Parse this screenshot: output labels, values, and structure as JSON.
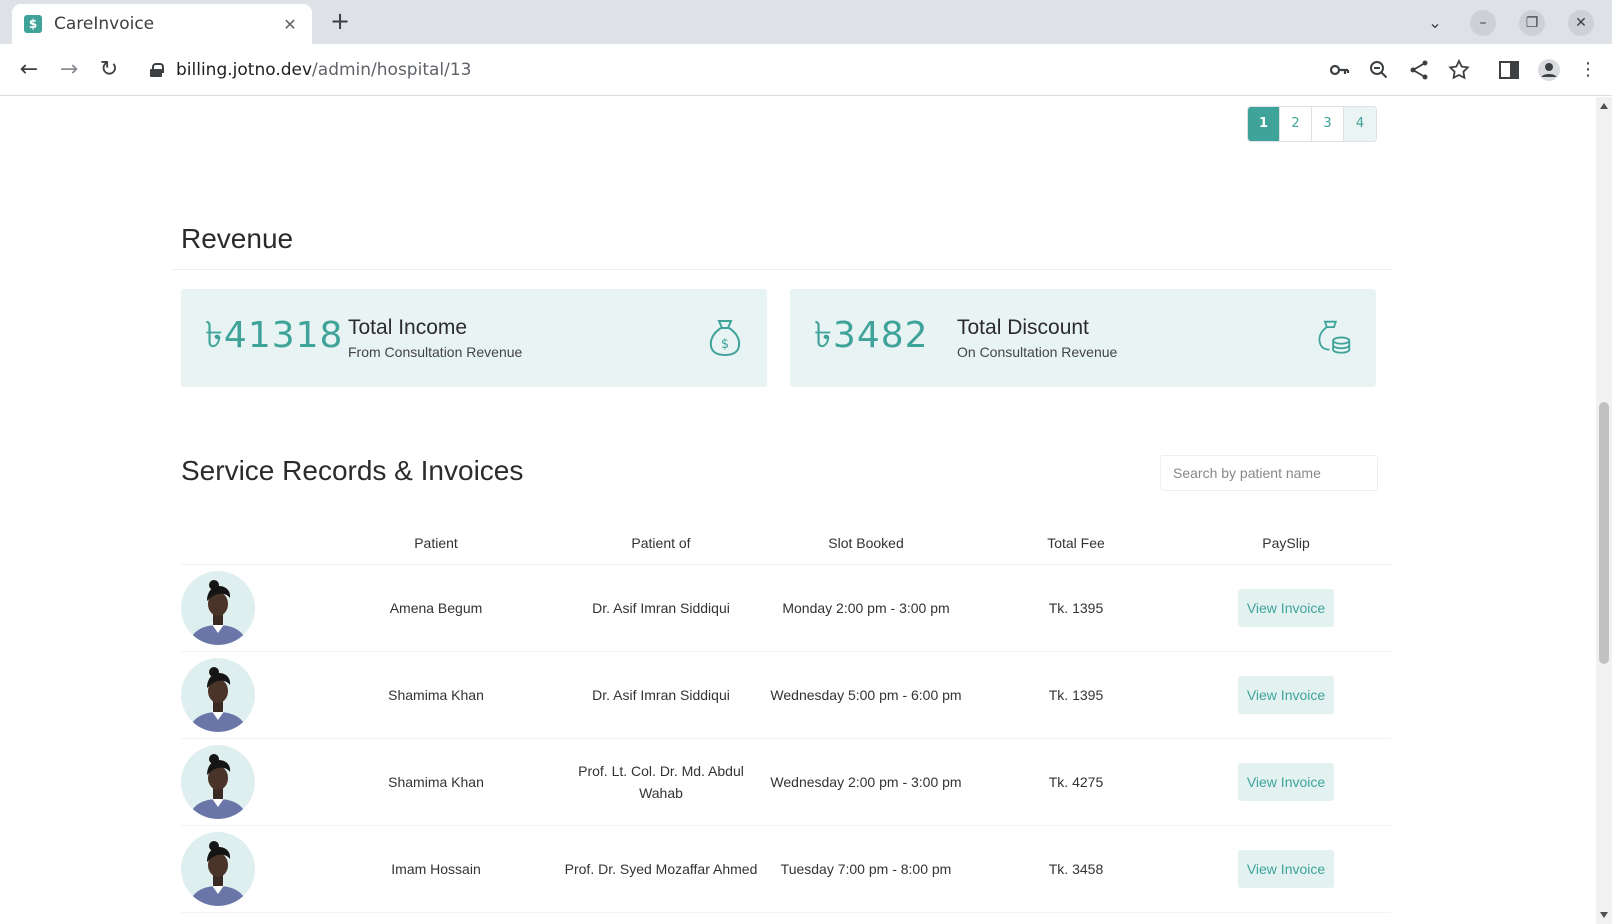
{
  "browser": {
    "tab_title": "CareInvoice",
    "url_host": "billing.jotno.dev",
    "url_path": "/admin/hospital/13"
  },
  "pagination": [
    "1",
    "2",
    "3",
    "4"
  ],
  "pagination_active": "1",
  "revenue": {
    "title": "Revenue",
    "income": {
      "amount": "৳41318",
      "label": "Total Income",
      "sub": "From Consultation Revenue"
    },
    "discount": {
      "amount": "৳3482",
      "label": "Total Discount",
      "sub": "On Consultation Revenue"
    }
  },
  "records": {
    "title": "Service Records & Invoices",
    "search_placeholder": "Search by patient name",
    "columns": [
      "Patient",
      "Patient of",
      "Slot Booked",
      "Total Fee",
      "PaySlip"
    ],
    "rows": [
      {
        "patient": "Amena Begum",
        "doctor": "Dr. Asif Imran Siddiqui",
        "slot": "Monday 2:00 pm - 3:00 pm",
        "fee": "Tk. 1395",
        "action": "View Invoice"
      },
      {
        "patient": "Shamima Khan",
        "doctor": "Dr. Asif Imran Siddiqui",
        "slot": "Wednesday 5:00 pm - 6:00 pm",
        "fee": "Tk. 1395",
        "action": "View Invoice"
      },
      {
        "patient": "Shamima Khan",
        "doctor": "Prof. Lt. Col. Dr. Md. Abdul Wahab",
        "slot": "Wednesday 2:00 pm - 3:00 pm",
        "fee": "Tk. 4275",
        "action": "View Invoice"
      },
      {
        "patient": "Imam Hossain",
        "doctor": "Prof. Dr. Syed Mozaffar Ahmed",
        "slot": "Tuesday 7:00 pm - 8:00 pm",
        "fee": "Tk. 3458",
        "action": "View Invoice"
      }
    ]
  },
  "colors": {
    "accent": "#3fa39a",
    "card_bg": "#e8f4f3"
  }
}
